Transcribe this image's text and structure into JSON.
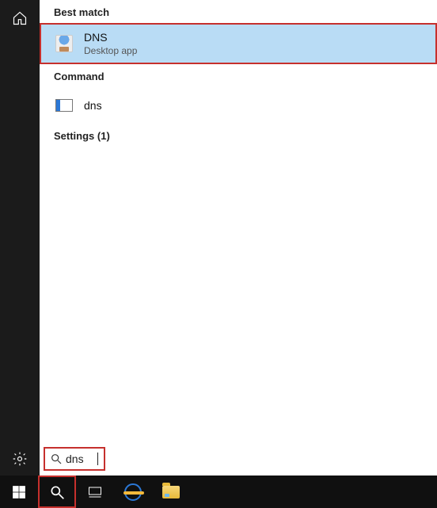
{
  "sections": {
    "best_match": "Best match",
    "command": "Command",
    "settings": "Settings (1)"
  },
  "results": {
    "best_match": {
      "title": "DNS",
      "subtitle": "Desktop app"
    },
    "command": {
      "title": "dns"
    }
  },
  "search": {
    "value": "dns",
    "placeholder": ""
  }
}
